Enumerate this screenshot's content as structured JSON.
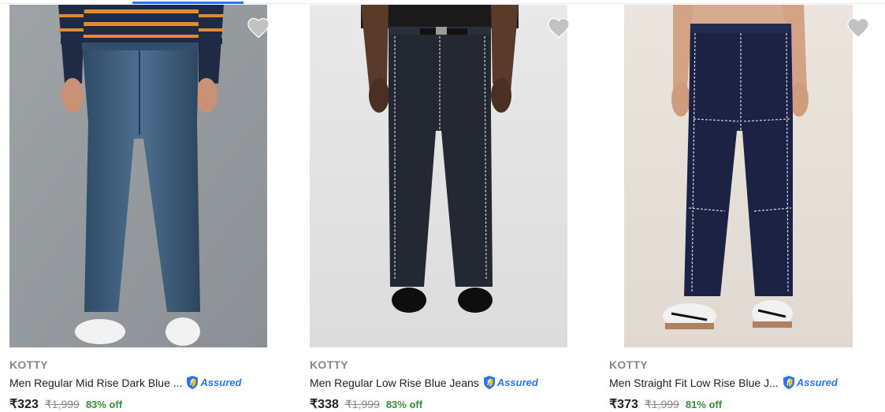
{
  "colors": {
    "accent": "#2874f0",
    "discount": "#388e3c",
    "muted": "#878787",
    "heart": "#c2c2c2"
  },
  "products": [
    {
      "brand": "KOTTY",
      "title": "Men Regular Mid Rise Dark Blue ...",
      "assured": "Assured",
      "price": "₹323",
      "mrp": "₹1,999",
      "discount": "83% off",
      "wishlist_icon": "heart-icon",
      "image": "dark-blue-jeans-photo"
    },
    {
      "brand": "KOTTY",
      "title": "Men Regular Low Rise Blue Jeans",
      "assured": "Assured",
      "price": "₹338",
      "mrp": "₹1,999",
      "discount": "83% off",
      "wishlist_icon": "heart-icon",
      "image": "black-jeans-photo"
    },
    {
      "brand": "KOTTY",
      "title": "Men Straight Fit Low Rise Blue J...",
      "assured": "Assured",
      "price": "₹373",
      "mrp": "₹1,999",
      "discount": "81% off",
      "wishlist_icon": "heart-icon",
      "image": "navy-jeans-photo"
    }
  ]
}
